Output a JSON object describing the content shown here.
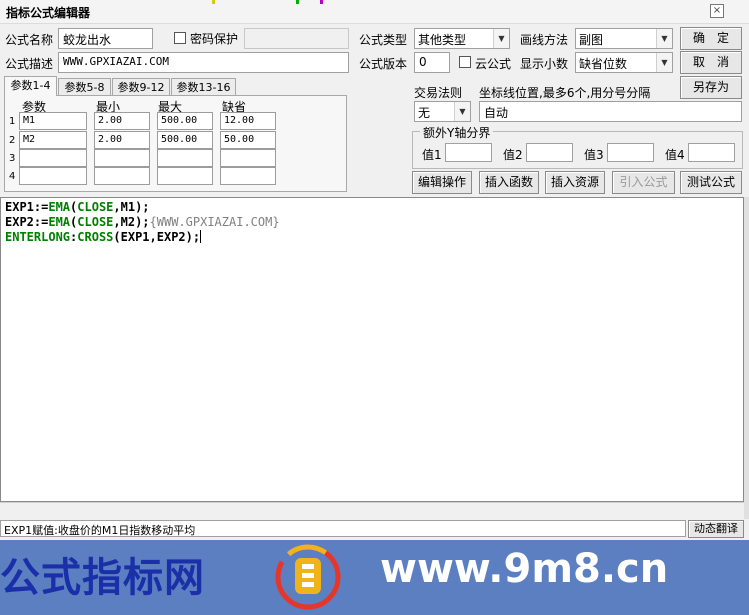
{
  "window": {
    "title": "指标公式编辑器",
    "close": "×"
  },
  "formula": {
    "name_label": "公式名称",
    "name_value": "蛟龙出水",
    "password_label": "密码保护",
    "desc_label": "公式描述",
    "desc_value": "WWW.GPXIAZAI.COM",
    "type_label": "公式类型",
    "type_value": "其他类型",
    "version_label": "公式版本",
    "version_value": "0",
    "cloud_label": "云公式",
    "draw_label": "画线方法",
    "draw_value": "副图",
    "decimals_label": "显示小数",
    "decimals_value": "缺省位数"
  },
  "buttons": {
    "ok": "确　定",
    "cancel": "取　消",
    "save_as": "另存为",
    "edit_ops": "编辑操作",
    "insert_func": "插入函数",
    "insert_res": "插入资源",
    "import_formula": "引入公式",
    "test_formula": "测试公式",
    "translate": "动态翻译"
  },
  "tabs": [
    "参数1-4",
    "参数5-8",
    "参数9-12",
    "参数13-16"
  ],
  "params": {
    "headers": [
      "参数",
      "最小",
      "最大",
      "缺省"
    ],
    "rows": [
      {
        "num": "1",
        "name": "M1",
        "min": "2.00",
        "max": "500.00",
        "def": "12.00"
      },
      {
        "num": "2",
        "name": "M2",
        "min": "2.00",
        "max": "500.00",
        "def": "50.00"
      },
      {
        "num": "3",
        "name": "",
        "min": "",
        "max": "",
        "def": ""
      },
      {
        "num": "4",
        "name": "",
        "min": "",
        "max": "",
        "def": ""
      }
    ]
  },
  "trade": {
    "rule_label": "交易法则",
    "rule_value": "无",
    "coord_label": "坐标线位置,最多6个,用分号分隔",
    "coord_value": "自动"
  },
  "yaxis": {
    "legend": "额外Y轴分界",
    "labels": [
      "值1",
      "值2",
      "值3",
      "值4"
    ]
  },
  "code": {
    "line1": [
      "EXP1:=",
      "EMA",
      "(",
      "CLOSE",
      ",M1);"
    ],
    "line2": [
      "EXP2:=",
      "EMA",
      "(",
      "CLOSE",
      ",M2);",
      "{WWW.GPXIAZAI.COM}"
    ],
    "line3": [
      "ENTERLONG",
      ":",
      "CROSS",
      "(EXP1,EXP2);"
    ]
  },
  "status_text": "EXP1赋值:收盘价的M1日指数移动平均",
  "banner": {
    "left_text": "公式指标网",
    "right_text": "www.9m8.cn",
    "colors": {
      "background": "#5b7fc0",
      "left": "#1a2fa8",
      "right": "#ffffff"
    }
  },
  "colors": {
    "code_keyword": "#008000",
    "code_function": "#0000aa",
    "code_comment": "#808080"
  }
}
